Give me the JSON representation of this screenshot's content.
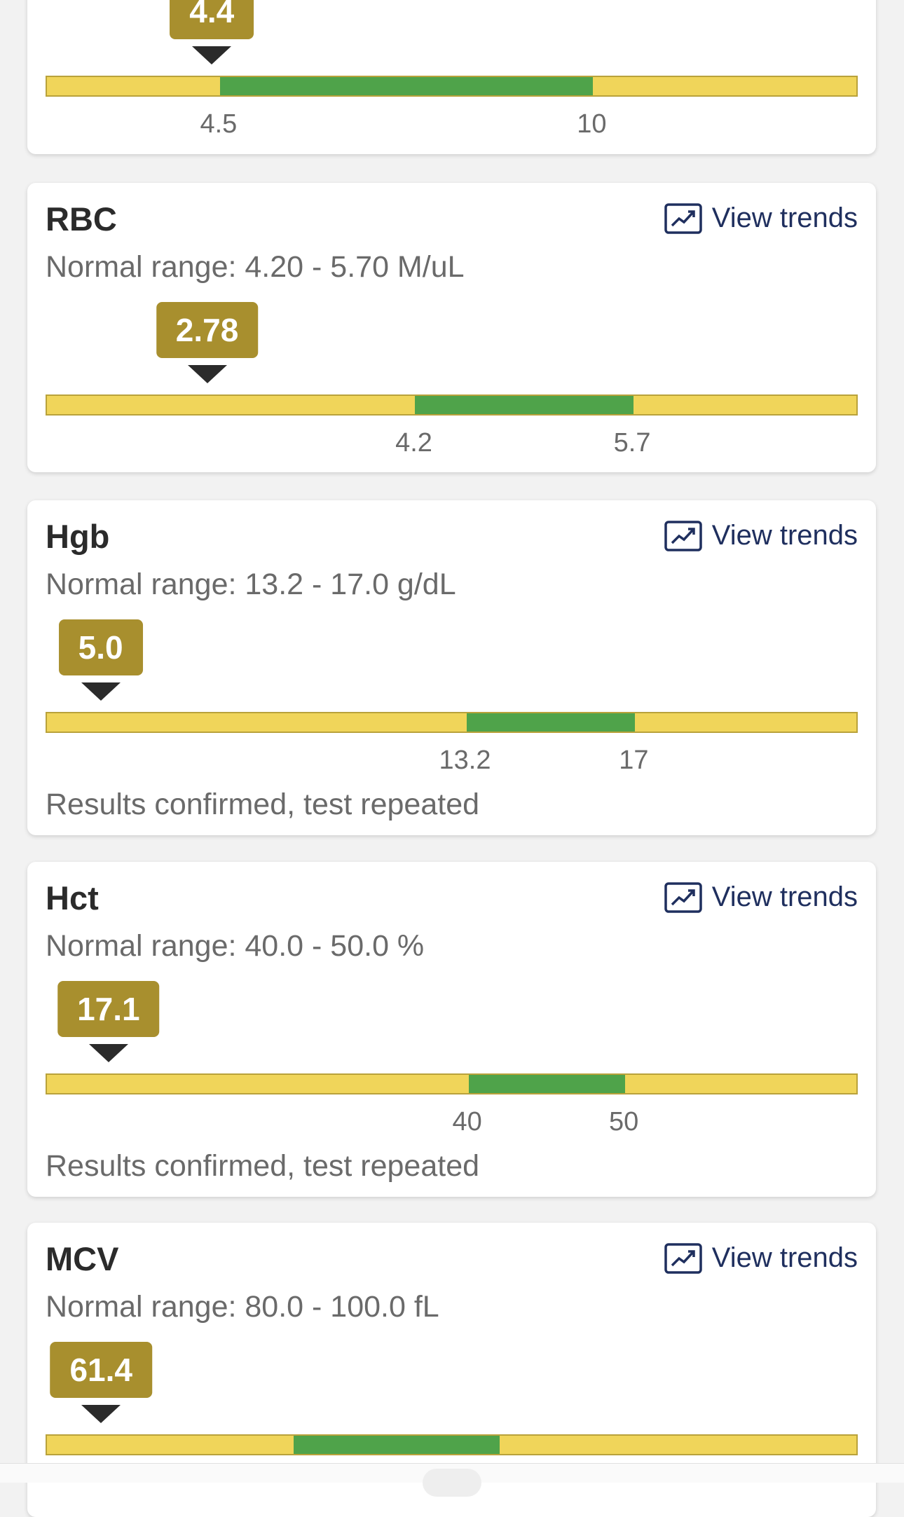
{
  "colors": {
    "badge": "#a88f2e",
    "out_of_range": "#f0d55a",
    "in_range": "#4fa34a",
    "link": "#1f2f5e"
  },
  "view_trends_label": "View trends",
  "trend_icon": "trend-chart-icon",
  "cards": [
    {
      "id": "wbc-partial",
      "value": "4.4",
      "scale": [
        1.95,
        13.92
      ],
      "normal": [
        4.5,
        10
      ],
      "ticks": [
        "4.5",
        "10"
      ]
    },
    {
      "id": "rbc",
      "title": "RBC",
      "range": "Normal range: 4.20 - 5.70 M/uL",
      "value": "2.78",
      "scale": [
        1.67,
        7.25
      ],
      "normal": [
        4.2,
        5.7
      ],
      "ticks": [
        "4.2",
        "5.7"
      ]
    },
    {
      "id": "hgb",
      "title": "Hgb",
      "range": "Normal range: 13.2 - 17.0 g/dL",
      "value": "5.0",
      "scale": [
        3.76,
        22.04
      ],
      "normal": [
        13.2,
        17
      ],
      "ticks": [
        "13.2",
        "17"
      ],
      "note": "Results confirmed, test repeated"
    },
    {
      "id": "hct",
      "title": "Hct",
      "range": "Normal range: 40.0 - 50.0 %",
      "value": "17.1",
      "scale": [
        13.08,
        64.94
      ],
      "normal": [
        40,
        50
      ],
      "ticks": [
        "40",
        "50"
      ],
      "note": "Results confirmed, test repeated"
    },
    {
      "id": "mcv",
      "title": "MCV",
      "range": "Normal range: 80.0 - 100.0 fL",
      "value": "61.4",
      "scale": [
        56.0,
        135.0
      ],
      "normal": [
        80,
        100
      ],
      "ticks": []
    }
  ]
}
